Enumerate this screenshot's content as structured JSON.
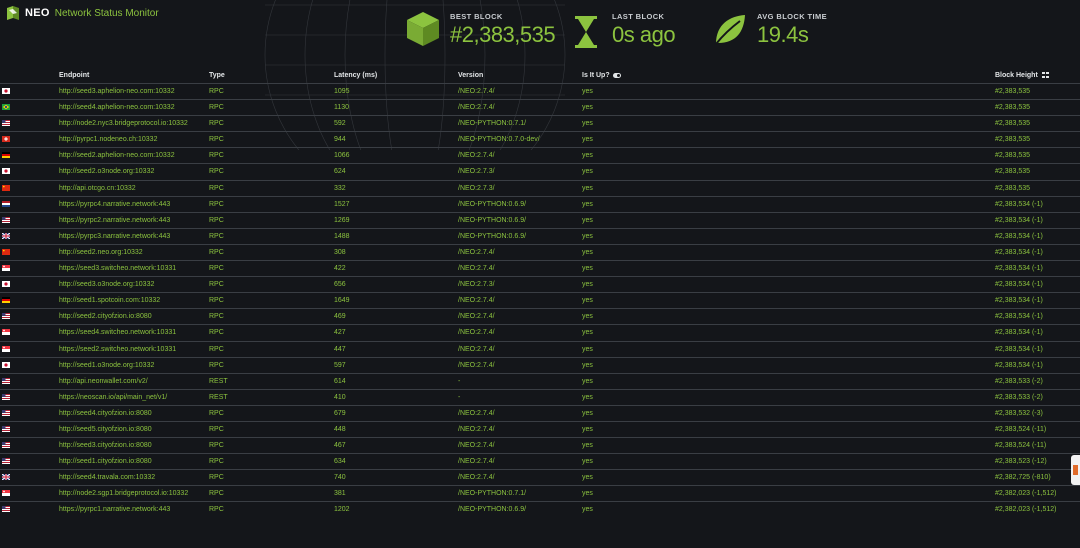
{
  "brand": {
    "name": "NEO",
    "subtitle": "Network Status Monitor"
  },
  "colors": {
    "accent": "#8cc33f",
    "background": "#14161a",
    "header_text": "#e3e6e8"
  },
  "stats": [
    {
      "icon": "cube-icon",
      "label": "BEST BLOCK",
      "value": "#2,383,535"
    },
    {
      "icon": "hourglass-icon",
      "label": "LAST BLOCK",
      "value": "0s ago"
    },
    {
      "icon": "leaf-icon",
      "label": "AVG BLOCK TIME",
      "value": "19.4s"
    }
  ],
  "table": {
    "headers": {
      "endpoint": "Endpoint",
      "type": "Type",
      "latency": "Latency (ms)",
      "version": "Version",
      "is_up": "Is It Up?",
      "block_height": "Block Height"
    },
    "rows": [
      {
        "flag": "jp",
        "endpoint": "http://seed3.aphelion-neo.com:10332",
        "type": "RPC",
        "latency": "1095",
        "version": "/NEO:2.7.4/",
        "up": "yes",
        "height": "#2,383,535"
      },
      {
        "flag": "br",
        "endpoint": "http://seed4.aphelion-neo.com:10332",
        "type": "RPC",
        "latency": "1130",
        "version": "/NEO:2.7.4/",
        "up": "yes",
        "height": "#2,383,535"
      },
      {
        "flag": "us",
        "endpoint": "http://node2.nyc3.bridgeprotocol.io:10332",
        "type": "RPC",
        "latency": "592",
        "version": "/NEO-PYTHON:0.7.1/",
        "up": "yes",
        "height": "#2,383,535"
      },
      {
        "flag": "ch",
        "endpoint": "http://pyrpc1.nodeneo.ch:10332",
        "type": "RPC",
        "latency": "944",
        "version": "/NEO-PYTHON:0.7.0-dev/",
        "up": "yes",
        "height": "#2,383,535"
      },
      {
        "flag": "de",
        "endpoint": "http://seed2.aphelion-neo.com:10332",
        "type": "RPC",
        "latency": "1066",
        "version": "/NEO:2.7.4/",
        "up": "yes",
        "height": "#2,383,535"
      },
      {
        "flag": "jp",
        "endpoint": "http://seed2.o3node.org:10332",
        "type": "RPC",
        "latency": "624",
        "version": "/NEO:2.7.3/",
        "up": "yes",
        "height": "#2,383,535"
      },
      {
        "flag": "cn",
        "endpoint": "http://api.otcgo.cn:10332",
        "type": "RPC",
        "latency": "332",
        "version": "/NEO:2.7.3/",
        "up": "yes",
        "height": "#2,383,535"
      },
      {
        "flag": "nl",
        "endpoint": "https://pyrpc4.narrative.network:443",
        "type": "RPC",
        "latency": "1527",
        "version": "/NEO-PYTHON:0.6.9/",
        "up": "yes",
        "height": "#2,383,534 (-1)"
      },
      {
        "flag": "us",
        "endpoint": "https://pyrpc2.narrative.network:443",
        "type": "RPC",
        "latency": "1269",
        "version": "/NEO-PYTHON:0.6.9/",
        "up": "yes",
        "height": "#2,383,534 (-1)"
      },
      {
        "flag": "gb",
        "endpoint": "https://pyrpc3.narrative.network:443",
        "type": "RPC",
        "latency": "1488",
        "version": "/NEO-PYTHON:0.6.9/",
        "up": "yes",
        "height": "#2,383,534 (-1)"
      },
      {
        "flag": "cn",
        "endpoint": "http://seed2.neo.org:10332",
        "type": "RPC",
        "latency": "308",
        "version": "/NEO:2.7.4/",
        "up": "yes",
        "height": "#2,383,534 (-1)"
      },
      {
        "flag": "sg",
        "endpoint": "https://seed3.switcheo.network:10331",
        "type": "RPC",
        "latency": "422",
        "version": "/NEO:2.7.4/",
        "up": "yes",
        "height": "#2,383,534 (-1)"
      },
      {
        "flag": "jp",
        "endpoint": "http://seed3.o3node.org:10332",
        "type": "RPC",
        "latency": "656",
        "version": "/NEO:2.7.3/",
        "up": "yes",
        "height": "#2,383,534 (-1)"
      },
      {
        "flag": "de",
        "endpoint": "http://seed1.spotcoin.com:10332",
        "type": "RPC",
        "latency": "1649",
        "version": "/NEO:2.7.4/",
        "up": "yes",
        "height": "#2,383,534 (-1)"
      },
      {
        "flag": "us",
        "endpoint": "http://seed2.cityofzion.io:8080",
        "type": "RPC",
        "latency": "469",
        "version": "/NEO:2.7.4/",
        "up": "yes",
        "height": "#2,383,534 (-1)"
      },
      {
        "flag": "sg",
        "endpoint": "https://seed4.switcheo.network:10331",
        "type": "RPC",
        "latency": "427",
        "version": "/NEO:2.7.4/",
        "up": "yes",
        "height": "#2,383,534 (-1)"
      },
      {
        "flag": "sg",
        "endpoint": "https://seed2.switcheo.network:10331",
        "type": "RPC",
        "latency": "447",
        "version": "/NEO:2.7.4/",
        "up": "yes",
        "height": "#2,383,534 (-1)"
      },
      {
        "flag": "jp",
        "endpoint": "http://seed1.o3node.org:10332",
        "type": "RPC",
        "latency": "597",
        "version": "/NEO:2.7.4/",
        "up": "yes",
        "height": "#2,383,534 (-1)"
      },
      {
        "flag": "us",
        "endpoint": "http://api.neonwallet.com/v2/",
        "type": "REST",
        "latency": "614",
        "version": "-",
        "up": "yes",
        "height": "#2,383,533 (-2)"
      },
      {
        "flag": "us",
        "endpoint": "https://neoscan.io/api/main_net/v1/",
        "type": "REST",
        "latency": "410",
        "version": "-",
        "up": "yes",
        "height": "#2,383,533 (-2)"
      },
      {
        "flag": "us",
        "endpoint": "http://seed4.cityofzion.io:8080",
        "type": "RPC",
        "latency": "679",
        "version": "/NEO:2.7.4/",
        "up": "yes",
        "height": "#2,383,532 (-3)"
      },
      {
        "flag": "us",
        "endpoint": "http://seed5.cityofzion.io:8080",
        "type": "RPC",
        "latency": "448",
        "version": "/NEO:2.7.4/",
        "up": "yes",
        "height": "#2,383,524 (-11)"
      },
      {
        "flag": "us",
        "endpoint": "http://seed3.cityofzion.io:8080",
        "type": "RPC",
        "latency": "467",
        "version": "/NEO:2.7.4/",
        "up": "yes",
        "height": "#2,383,524 (-11)"
      },
      {
        "flag": "us",
        "endpoint": "http://seed1.cityofzion.io:8080",
        "type": "RPC",
        "latency": "634",
        "version": "/NEO:2.7.4/",
        "up": "yes",
        "height": "#2,383,523 (-12)"
      },
      {
        "flag": "gb",
        "endpoint": "http://seed4.travala.com:10332",
        "type": "RPC",
        "latency": "740",
        "version": "/NEO:2.7.4/",
        "up": "yes",
        "height": "#2,382,725 (-810)"
      },
      {
        "flag": "sg",
        "endpoint": "http://node2.sgp1.bridgeprotocol.io:10332",
        "type": "RPC",
        "latency": "381",
        "version": "/NEO-PYTHON:0.7.1/",
        "up": "yes",
        "height": "#2,382,023 (-1,512)"
      },
      {
        "flag": "us",
        "endpoint": "https://pyrpc1.narrative.network:443",
        "type": "RPC",
        "latency": "1202",
        "version": "/NEO-PYTHON:0.6.9/",
        "up": "yes",
        "height": "#2,382,023 (-1,512)"
      }
    ]
  }
}
